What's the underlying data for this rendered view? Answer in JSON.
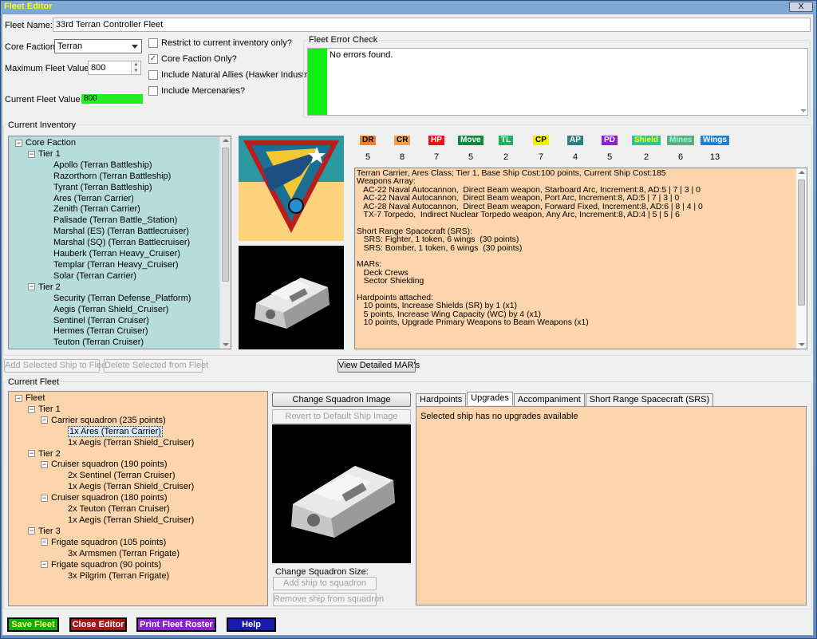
{
  "window": {
    "title": "Fleet Editor",
    "close": "X"
  },
  "fleet_name": {
    "label": "Fleet Name:",
    "value": "33rd Terran Controller Fleet"
  },
  "core_faction": {
    "label": "Core Faction:",
    "value": "Terran"
  },
  "max_value": {
    "label": "Maximum Fleet Value :",
    "value": "800"
  },
  "current_value": {
    "label": "Current Fleet Value :",
    "value": "800",
    "color": "#22ee22"
  },
  "options": [
    {
      "label": "Restrict to current inventory only?",
      "checked": false
    },
    {
      "label": "Core Faction Only?",
      "checked": true
    },
    {
      "label": "Include Natural Allies (Hawker Industries)",
      "checked": false
    },
    {
      "label": "Include Mercenaries?",
      "checked": false
    }
  ],
  "error_check": {
    "title": "Fleet Error Check",
    "message": "No errors found.",
    "status_color": "#11ee11"
  },
  "inventory": {
    "title": "Current Inventory",
    "root": "Core Faction",
    "tiers": [
      {
        "label": "Tier 1",
        "ships": [
          "Apollo (Terran Battleship)",
          "Razorthorn (Terran Battleship)",
          "Tyrant (Terran Battleship)",
          "Ares (Terran Carrier)",
          "Zenith (Terran Carrier)",
          "Palisade (Terran Battle_Station)",
          "Marshal (ES) (Terran Battlecruiser)",
          "Marshal (SQ) (Terran Battlecruiser)",
          "Hauberk (Terran Heavy_Cruiser)",
          "Templar (Terran Heavy_Cruiser)",
          "Solar (Terran Carrier)"
        ]
      },
      {
        "label": "Tier 2",
        "ships": [
          "Security (Terran Defense_Platform)",
          "Aegis (Terran Shield_Cruiser)",
          "Sentinel (Terran Cruiser)",
          "Hermes (Terran Cruiser)",
          "Teuton (Terran Cruiser)"
        ]
      }
    ],
    "bg_color": "#b7dcdc"
  },
  "stats": [
    {
      "label": "DR",
      "value": "5",
      "bg": "#f08030",
      "fg": "#000"
    },
    {
      "label": "CR",
      "value": "8",
      "bg": "#f0a050",
      "fg": "#000"
    },
    {
      "label": "HP",
      "value": "7",
      "bg": "#ee1111",
      "fg": "#fff"
    },
    {
      "label": "Move",
      "value": "5",
      "bg": "#11883a",
      "fg": "#fff"
    },
    {
      "label": "TL",
      "value": "2",
      "bg": "#20b060",
      "fg": "#fff"
    },
    {
      "label": "CP",
      "value": "7",
      "bg": "#f0f000",
      "fg": "#000"
    },
    {
      "label": "AP",
      "value": "4",
      "bg": "#2f8080",
      "fg": "#fff"
    },
    {
      "label": "PD",
      "value": "5",
      "bg": "#8a22cc",
      "fg": "#fff"
    },
    {
      "label": "Shield",
      "value": "2",
      "bg": "#30c0a0",
      "fg": "#ff0"
    },
    {
      "label": "Mines",
      "value": "6",
      "bg": "#60a880",
      "fg": "#8fd"
    },
    {
      "label": "Wings",
      "value": "13",
      "bg": "#1f7fd0",
      "fg": "#fff"
    }
  ],
  "ship_info": [
    "Terran Carrier, Ares Class; Tier 1, Base Ship Cost:100 points, Current Ship Cost:185",
    "Weapons Array:",
    "   AC-22 Naval Autocannon,  Direct Beam weapon, Starboard Arc, Increment:8, AD:5 | 7 | 3 | 0",
    "   AC-22 Naval Autocannon,  Direct Beam weapon, Port Arc, Increment:8, AD:5 | 7 | 3 | 0",
    "   AC-28 Naval Autocannon,  Direct Beam weapon, Forward Fixed, Increment:8, AD:6 | 8 | 4 | 0",
    "   TX-7 Torpedo,  Indirect Nuclear Torpedo weapon, Any Arc, Increment:8, AD:4 | 5 | 5 | 6",
    "",
    "Short Range Spacecraft (SRS):",
    "   SRS: Fighter, 1 token, 6 wings  (30 points)",
    "   SRS: Bomber, 1 token, 6 wings  (30 points)",
    "",
    "MARs:",
    "   Deck Crews",
    "   Sector Shielding",
    "",
    "Hardpoints attached:",
    "   10 points, Increase Shields (SR) by 1 (x1)",
    "   5 points, Increase Wing Capacity (WC) by 4 (x1)",
    "   10 points, Upgrade Primary Weapons to Beam Weapons (x1)"
  ],
  "inventory_buttons": {
    "add": "Add Selected Ship to Fleet",
    "delete": "Delete Selected from Fleet",
    "mars": "View Detailed MAR's"
  },
  "fleet": {
    "title": "Current Fleet",
    "root": "Fleet",
    "bg_color": "#fcd5ac",
    "tiers": [
      {
        "label": "Tier 1",
        "squadrons": [
          {
            "label": "Carrier squadron (235 points)",
            "ships": [
              "1x Ares (Terran Carrier)",
              "1x Aegis (Terran Shield_Cruiser)"
            ]
          }
        ]
      },
      {
        "label": "Tier 2",
        "squadrons": [
          {
            "label": "Cruiser squadron (190 points)",
            "ships": [
              "2x Sentinel (Terran Cruiser)",
              "1x Aegis (Terran Shield_Cruiser)"
            ]
          },
          {
            "label": "Cruiser squadron (180 points)",
            "ships": [
              "2x Teuton (Terran Cruiser)",
              "1x Aegis (Terran Shield_Cruiser)"
            ]
          }
        ]
      },
      {
        "label": "Tier 3",
        "squadrons": [
          {
            "label": "Frigate squadron (105 points)",
            "ships": [
              "3x Armsmen (Terran Frigate)"
            ]
          },
          {
            "label": "Frigate squadron (90 points)",
            "ships": [
              "3x Pilgrim (Terran Frigate)"
            ]
          }
        ]
      }
    ],
    "selected": "1x Ares (Terran Carrier)"
  },
  "squadron": {
    "change_image": "Change Squadron Image",
    "revert_image": "Revert to Default Ship Image",
    "size_label": "Change Squadron Size:",
    "add_ship": "Add ship to squadron",
    "remove_ship": "Remove ship from squadron"
  },
  "detail_tabs": [
    "Hardpoints",
    "Upgrades",
    "Accompaniment",
    "Short Range Spacecraft (SRS)"
  ],
  "detail_text": "Selected ship has no upgrades available",
  "footer": [
    {
      "label": "Save Fleet",
      "bg": "#11aa11",
      "fg": "#ffff66"
    },
    {
      "label": "Close Editor",
      "bg": "#a01818",
      "fg": "#ffffff"
    },
    {
      "label": "Print Fleet Roster",
      "bg": "#8a22cc",
      "fg": "#ffffff"
    },
    {
      "label": "Help",
      "bg": "#1a1aa8",
      "fg": "#ffffff"
    }
  ]
}
